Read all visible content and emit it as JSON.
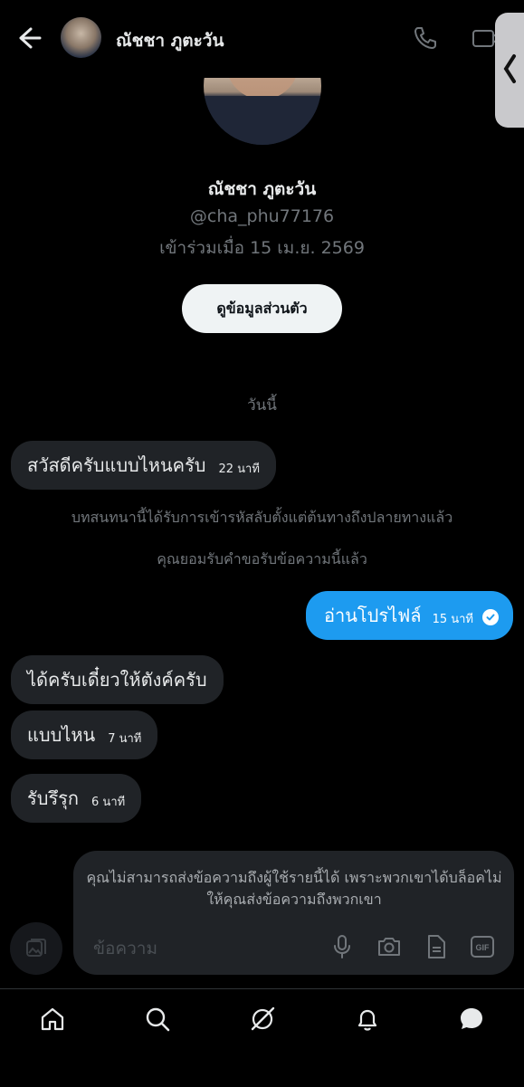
{
  "header": {
    "contact_name": "ณัชชา ภูตะวัน"
  },
  "profile": {
    "name": "ณัชชา ภูตะวัน",
    "handle": "@cha_phu77176",
    "joined": "เข้าร่วมเมื่อ 15 เม.ย. 2569",
    "view_profile_label": "ดูข้อมูลส่วนตัว"
  },
  "chat": {
    "date_divider": "วันนี้",
    "messages": [
      {
        "direction": "in",
        "text": "สวัสดีครับแบบไหนครับ",
        "time": "22 นาที"
      },
      {
        "direction": "out",
        "text": "อ่านโปรไฟล์",
        "time": "15 นาที",
        "status": "read"
      },
      {
        "direction": "in",
        "text": "ได้ครับเดี๋ยวให้ตังค์ครับ",
        "time": ""
      },
      {
        "direction": "in",
        "text": "แบบไหน",
        "time": "7 นาที"
      },
      {
        "direction": "in",
        "text": "รับรึรุก",
        "time": "6 นาที"
      }
    ],
    "system_messages": [
      "บทสนทนานี้ได้รับการเข้ารหัสลับตั้งแต่ต้นทางถึงปลายทางแล้ว",
      "คุณยอมรับคำขอรับข้อความนี้แล้ว"
    ]
  },
  "composer": {
    "blocked_notice": "คุณไม่สามารถส่งข้อความถึงผู้ใช้รายนี้ได้ เพราะพวกเขาได้บล็อคไม่ให้คุณส่งข้อความถึงพวกเขา",
    "placeholder": "ข้อความ",
    "gif_label": "GIF",
    "icons": [
      "gallery-icon",
      "microphone-icon",
      "camera-icon",
      "document-icon",
      "gif-icon"
    ]
  },
  "bottom_nav": {
    "items": [
      "home-icon",
      "search-icon",
      "grok-icon",
      "notifications-icon",
      "messages-icon"
    ],
    "active": "messages-icon"
  },
  "colors": {
    "background": "#000000",
    "incoming_bubble": "#202327",
    "outgoing_bubble": "#1d9bf0",
    "secondary_text": "#71767b"
  }
}
